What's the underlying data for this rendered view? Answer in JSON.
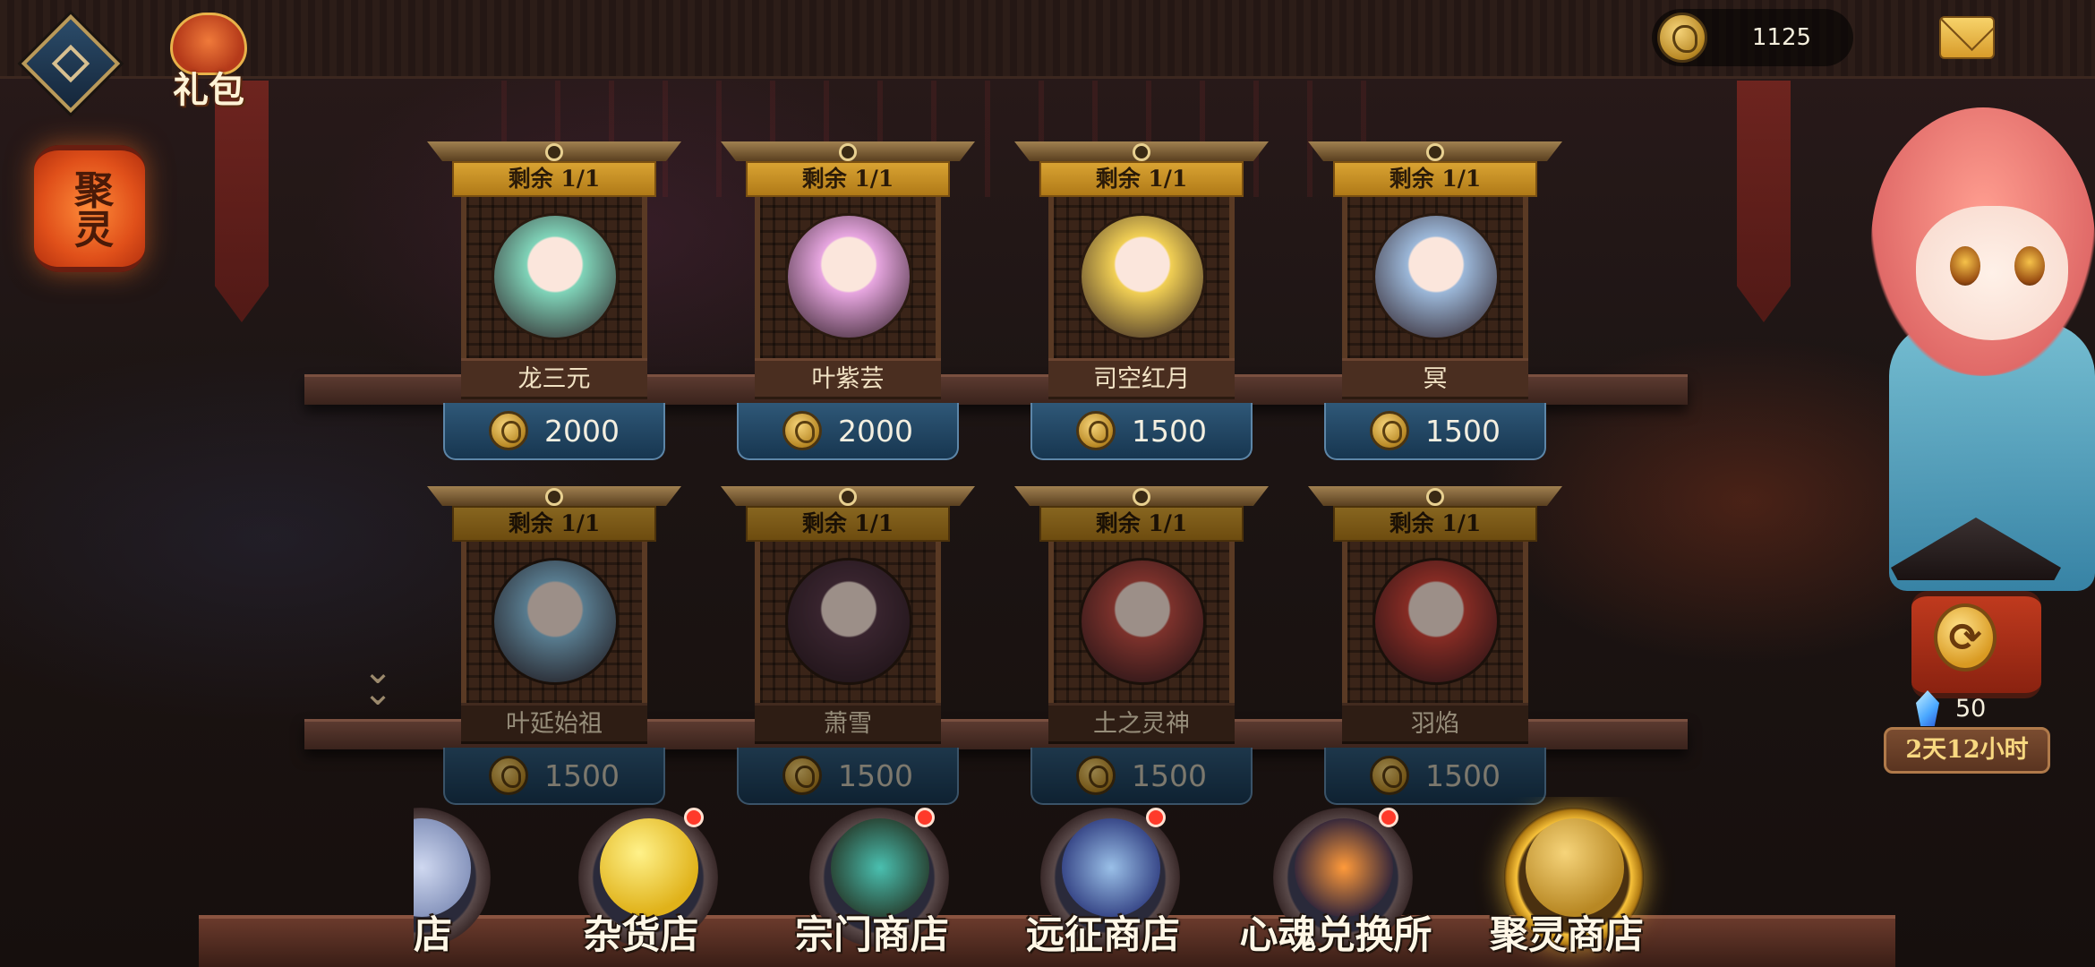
{
  "header": {
    "gift_label": "礼包",
    "currency_value": "1125"
  },
  "side": {
    "juling_label": "聚灵"
  },
  "shop": {
    "rows": [
      [
        {
          "stock": "剩余 1/1",
          "name": "龙三元",
          "price": "2000",
          "tint": "#7fd3b8"
        },
        {
          "stock": "剩余 1/1",
          "name": "叶紫芸",
          "price": "2000",
          "tint": "#e7a6e0"
        },
        {
          "stock": "剩余 1/1",
          "name": "司空红月",
          "price": "1500",
          "tint": "#f1cf54"
        },
        {
          "stock": "剩余 1/1",
          "name": "冥",
          "price": "1500",
          "tint": "#9bb7d8"
        }
      ],
      [
        {
          "stock": "剩余 1/1",
          "name": "叶延始祖",
          "price": "1500",
          "tint": "#8ec7e6"
        },
        {
          "stock": "剩余 1/1",
          "name": "萧雪",
          "price": "1500",
          "tint": "#5a3a4a"
        },
        {
          "stock": "剩余 1/1",
          "name": "土之灵神",
          "price": "1500",
          "tint": "#c85046"
        },
        {
          "stock": "剩余 1/1",
          "name": "羽焰",
          "price": "1500",
          "tint": "#d8463a"
        }
      ]
    ]
  },
  "refresh": {
    "gem_count": "50",
    "timer": "2天12小时"
  },
  "nav": {
    "items": [
      {
        "label": "商店",
        "icon": "partial-shop-icon",
        "badge": false,
        "active": false
      },
      {
        "label": "杂货店",
        "icon": "gold-coin-icon",
        "badge": true,
        "active": false
      },
      {
        "label": "宗门商店",
        "icon": "demon-mask-icon",
        "badge": true,
        "active": false
      },
      {
        "label": "远征商店",
        "icon": "ship-anchor-icon",
        "badge": true,
        "active": false
      },
      {
        "label": "心魂兑换所",
        "icon": "soul-crystal-icon",
        "badge": true,
        "active": false
      },
      {
        "label": "聚灵商店",
        "icon": "juling-coin-icon",
        "badge": false,
        "active": true
      }
    ]
  }
}
